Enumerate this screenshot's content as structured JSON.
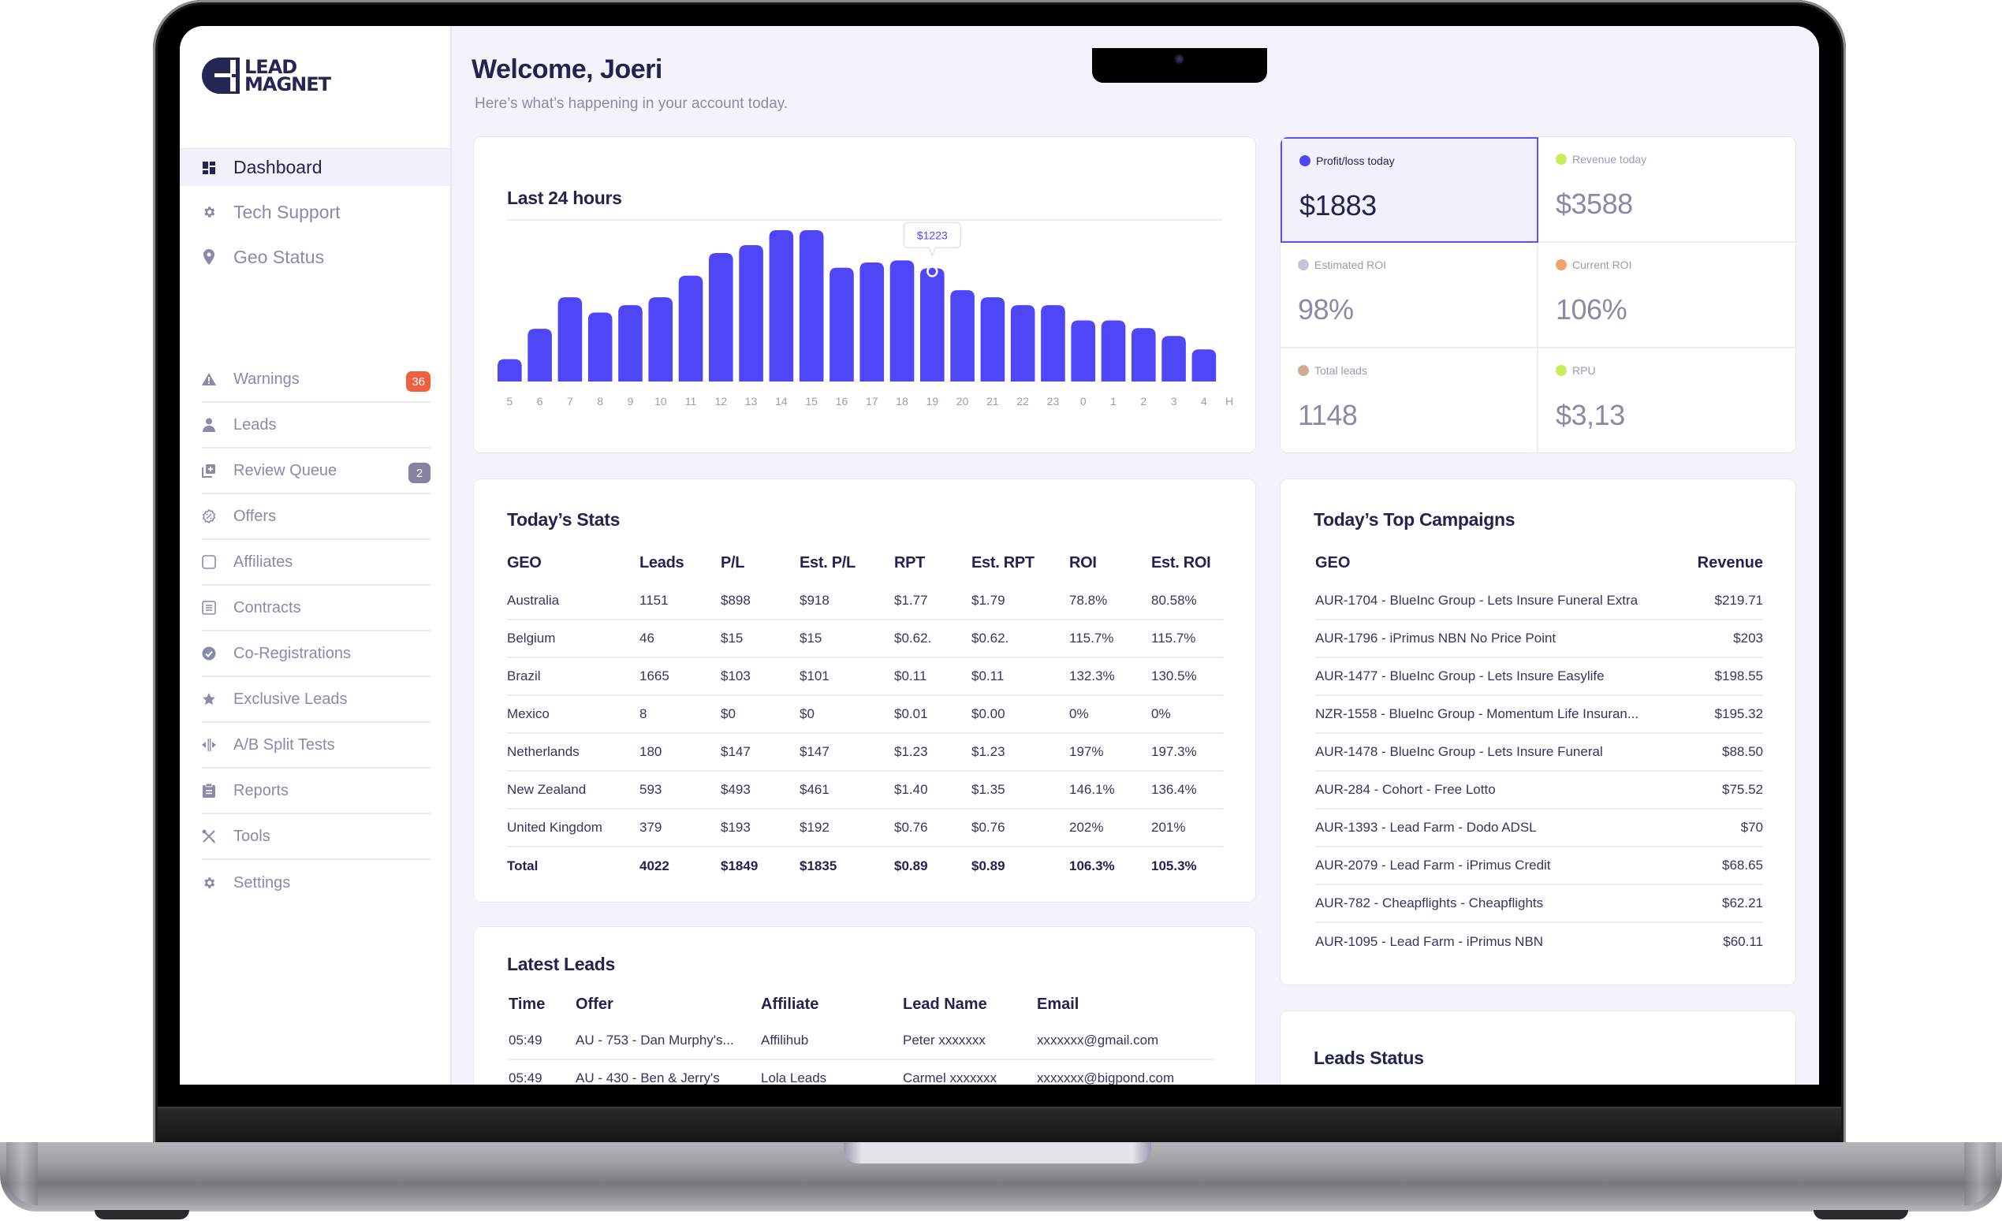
{
  "app": {
    "brand_line1": "LEAD",
    "brand_line2": "MAGNET"
  },
  "sidebar": {
    "primary": [
      {
        "label": "Dashboard",
        "icon": "dashboard-icon",
        "active": true
      },
      {
        "label": "Tech Support",
        "icon": "gear-icon"
      },
      {
        "label": "Geo Status",
        "icon": "map-pin-icon"
      }
    ],
    "secondary": [
      {
        "label": "Warnings",
        "icon": "warning-icon",
        "badge": "36",
        "badge_color": "#f0603f"
      },
      {
        "label": "Leads",
        "icon": "user-icon"
      },
      {
        "label": "Review Queue",
        "icon": "add-stack-icon",
        "badge": "2",
        "badge_color": "#8484a2"
      },
      {
        "label": "Offers",
        "icon": "discount-badge-icon"
      },
      {
        "label": "Affiliates",
        "icon": "square-icon"
      },
      {
        "label": "Contracts",
        "icon": "document-icon"
      },
      {
        "label": "Co-Registrations",
        "icon": "check-circle-icon"
      },
      {
        "label": "Exclusive Leads",
        "icon": "star-icon"
      },
      {
        "label": "A/B Split Tests",
        "icon": "split-icon"
      },
      {
        "label": "Reports",
        "icon": "clipboard-icon"
      },
      {
        "label": "Tools",
        "icon": "tools-icon"
      },
      {
        "label": "Settings",
        "icon": "settings-icon"
      }
    ]
  },
  "header": {
    "title": "Welcome, Joeri",
    "subtitle": "Here’s what’s happening in your account today."
  },
  "colors": {
    "accent": "#4f46f8",
    "text_dark": "#232350",
    "text_muted": "#8a8aa8",
    "bg": "#f3f3fc"
  },
  "chart_data": {
    "type": "bar",
    "title": "Last 24 hours",
    "xlabel": "",
    "ylabel": "",
    "categories": [
      "5",
      "6",
      "7",
      "8",
      "9",
      "10",
      "11",
      "12",
      "13",
      "14",
      "15",
      "16",
      "17",
      "18",
      "19",
      "20",
      "21",
      "22",
      "23",
      "0",
      "1",
      "2",
      "3",
      "4"
    ],
    "x_axis_suffix_label": "H",
    "values": [
      242,
      569,
      910,
      745,
      825,
      910,
      1143,
      1388,
      1473,
      1635,
      1635,
      1229,
      1286,
      1308,
      1223,
      987,
      910,
      825,
      825,
      660,
      660,
      577,
      492,
      347
    ],
    "ylim": [
      0,
      1635
    ],
    "grid": false,
    "bar_color": "#4f46f8",
    "tooltip": {
      "category": "19",
      "label": "$1223"
    }
  },
  "kpis": [
    {
      "label": "Profit/loss today",
      "value": "$1883",
      "dot": "#4f46f8",
      "highlight": true
    },
    {
      "label": "Revenue today",
      "value": "$3588",
      "dot": "#c4ef5a"
    },
    {
      "label": "Estimated ROI",
      "value": "98%",
      "dot": "#c4c4dc"
    },
    {
      "label": "Current ROI",
      "value": "106%",
      "dot": "#f4a268"
    },
    {
      "label": "Total leads",
      "value": "1148",
      "dot": "#d2aa94"
    },
    {
      "label": "RPU",
      "value": "$3,13",
      "dot": "#c4ef5a"
    }
  ],
  "todays_stats": {
    "title": "Today’s Stats",
    "columns": [
      "GEO",
      "Leads",
      "P/L",
      "Est. P/L",
      "RPT",
      "Est. RPT",
      "ROI",
      "Est. ROI"
    ],
    "rows": [
      [
        "Australia",
        "1151",
        "$898",
        "$918",
        "$1.77",
        "$1.79",
        "78.8%",
        "80.58%"
      ],
      [
        "Belgium",
        "46",
        "$15",
        "$15",
        "$0.62.",
        "$0.62.",
        "115.7%",
        "115.7%"
      ],
      [
        "Brazil",
        "1665",
        "$103",
        "$101",
        "$0.11",
        "$0.11",
        "132.3%",
        "130.5%"
      ],
      [
        "Mexico",
        "8",
        "$0",
        "$0",
        "$0.01",
        "$0.00",
        "0%",
        "0%"
      ],
      [
        "Netherlands",
        "180",
        "$147",
        "$147",
        "$1.23",
        "$1.23",
        "197%",
        "197.3%"
      ],
      [
        "New Zealand",
        "593",
        "$493",
        "$461",
        "$1.40",
        "$1.35",
        "146.1%",
        "136.4%"
      ],
      [
        "United Kingdom",
        "379",
        "$193",
        "$192",
        "$0.76",
        "$0.76",
        "202%",
        "201%"
      ]
    ],
    "total": [
      "Total",
      "4022",
      "$1849",
      "$1835",
      "$0.89",
      "$0.89",
      "106.3%",
      "105.3%"
    ]
  },
  "top_campaigns": {
    "title": "Today’s Top Campaigns",
    "columns": [
      "GEO",
      "Revenue"
    ],
    "rows": [
      [
        "AUR-1704 - BlueInc Group - Lets Insure Funeral Extra",
        "$219.71"
      ],
      [
        "AUR-1796 - iPrimus NBN No Price Point",
        "$203"
      ],
      [
        "AUR-1477 - BlueInc Group - Lets Insure Easylife",
        "$198.55"
      ],
      [
        "NZR-1558 - BlueInc Group - Momentum Life Insuran...",
        "$195.32"
      ],
      [
        "AUR-1478 - BlueInc Group - Lets Insure Funeral",
        "$88.50"
      ],
      [
        "AUR-284 - Cohort - Free Lotto",
        "$75.52"
      ],
      [
        "AUR-1393 - Lead Farm - Dodo ADSL",
        "$70"
      ],
      [
        "AUR-2079 - Lead Farm - iPrimus Credit",
        "$68.65"
      ],
      [
        "AUR-782 - Cheapflights - Cheapflights",
        "$62.21"
      ],
      [
        "AUR-1095 - Lead Farm - iPrimus NBN",
        "$60.11"
      ]
    ]
  },
  "latest_leads": {
    "title": "Latest Leads",
    "columns": [
      "Time",
      "Offer",
      "Affiliate",
      "Lead Name",
      "Email"
    ],
    "rows": [
      [
        "05:49",
        "AU - 753 - Dan Murphy's...",
        "Affilihub",
        "Peter xxxxxxx",
        "xxxxxxx@gmail.com"
      ],
      [
        "05:49",
        "AU - 430 - Ben & Jerry's",
        "Lola Leads",
        "Carmel xxxxxxx",
        "xxxxxxx@bigpond.com"
      ]
    ]
  },
  "leads_status": {
    "title": "Leads Status"
  }
}
